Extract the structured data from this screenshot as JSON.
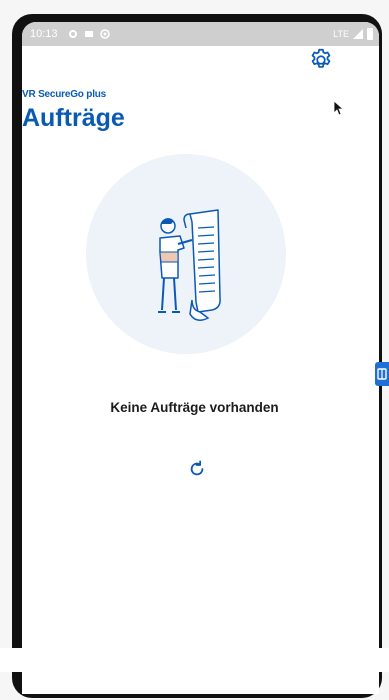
{
  "status_bar": {
    "time": "10:13",
    "network": "LTE",
    "icons": [
      "settings-gear-icon",
      "image-icon",
      "record-icon"
    ]
  },
  "header": {
    "app_name": "VR SecureGo plus",
    "title": "Aufträge"
  },
  "settings": {
    "icon": "gear-icon"
  },
  "empty_state": {
    "illustration": "person-with-document-illustration",
    "message": "Keine Aufträge vorhanden"
  },
  "refresh": {
    "icon": "refresh-icon"
  },
  "colors": {
    "brand_blue": "#0a5ab4",
    "circle_bg": "#eef2f9",
    "side_tab": "#1f6fd6",
    "text_dark": "#1c1c1c"
  }
}
